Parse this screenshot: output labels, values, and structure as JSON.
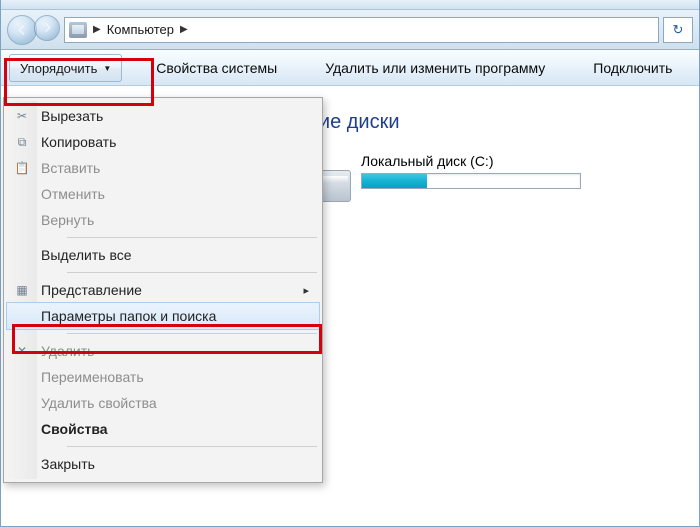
{
  "address": {
    "crumb": "Компьютер"
  },
  "toolbar": {
    "organize": "Упорядочить",
    "properties": "Свойства системы",
    "uninstall": "Удалить или изменить программу",
    "connect": "Подключить"
  },
  "section_title": "ткие диски",
  "drive": {
    "label": "Локальный диск (C:)",
    "fill_percent": 30
  },
  "menu": {
    "cut": "Вырезать",
    "copy": "Копировать",
    "paste": "Вставить",
    "undo": "Отменить",
    "redo": "Вернуть",
    "select_all": "Выделить все",
    "view": "Представление",
    "folder_options": "Параметры папок и поиска",
    "delete": "Удалить",
    "rename": "Переименовать",
    "delete_props": "Удалить свойства",
    "properties": "Свойства",
    "close": "Закрыть"
  }
}
